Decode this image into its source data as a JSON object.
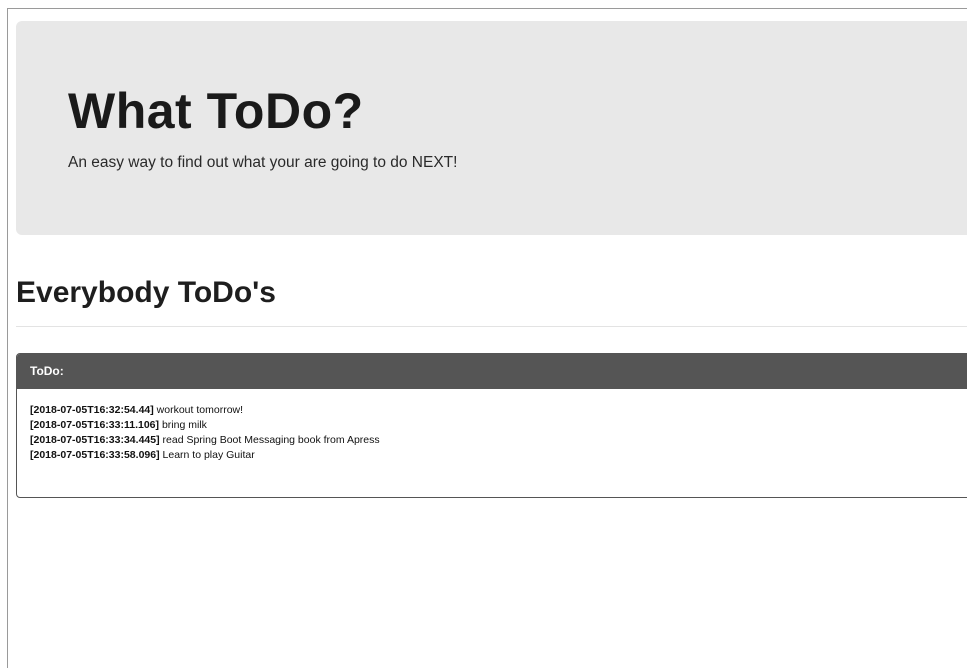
{
  "header": {
    "title": "What ToDo?",
    "subtitle": "An easy way to find out what your are going to do NEXT!"
  },
  "section": {
    "title": "Everybody ToDo's"
  },
  "panel": {
    "heading": "ToDo:",
    "items": [
      {
        "timestamp": "[2018-07-05T16:32:54.44]",
        "text": "workout tomorrow!"
      },
      {
        "timestamp": "[2018-07-05T16:33:11.106]",
        "text": "bring milk"
      },
      {
        "timestamp": "[2018-07-05T16:33:34.445]",
        "text": "read Spring Boot Messaging book from Apress"
      },
      {
        "timestamp": "[2018-07-05T16:33:58.096]",
        "text": "Learn to play Guitar"
      }
    ]
  }
}
